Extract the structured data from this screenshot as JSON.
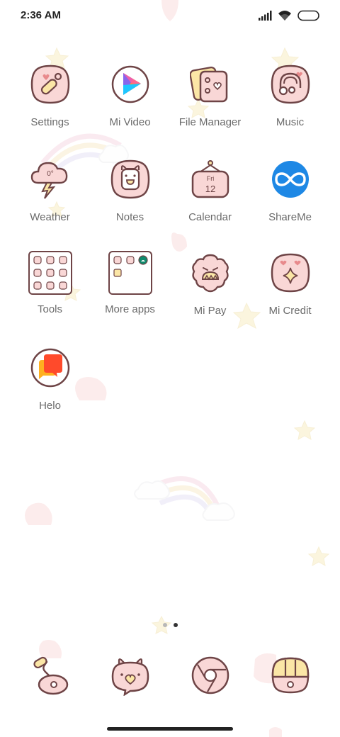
{
  "status_bar": {
    "time": "2:36 AM",
    "icons": [
      "signal-icon",
      "wifi-icon",
      "battery-icon"
    ]
  },
  "home": {
    "apps": [
      {
        "label": "Settings",
        "icon": "settings-icon"
      },
      {
        "label": "Mi Video",
        "icon": "mi-video-icon"
      },
      {
        "label": "File Manager",
        "icon": "file-manager-icon"
      },
      {
        "label": "Music",
        "icon": "music-icon"
      },
      {
        "label": "Weather",
        "icon": "weather-icon",
        "icon_text": "0°"
      },
      {
        "label": "Notes",
        "icon": "notes-icon"
      },
      {
        "label": "Calendar",
        "icon": "calendar-icon",
        "day": "Fri",
        "date": "12"
      },
      {
        "label": "ShareMe",
        "icon": "shareme-icon"
      },
      {
        "label": "Tools",
        "icon": "folder-icon"
      },
      {
        "label": "More apps",
        "icon": "folder-icon"
      },
      {
        "label": "Mi Pay",
        "icon": "mi-pay-icon"
      },
      {
        "label": "Mi Credit",
        "icon": "mi-credit-icon"
      },
      {
        "label": "Helo",
        "icon": "helo-icon"
      }
    ]
  },
  "pager": {
    "pages": 2,
    "current": 2
  },
  "dock": {
    "items": [
      {
        "icon": "phone-icon"
      },
      {
        "icon": "messages-icon"
      },
      {
        "icon": "browser-icon"
      },
      {
        "icon": "camera-icon"
      }
    ]
  },
  "colors": {
    "icon_fill": "#f9d7d6",
    "icon_stroke": "#6e4446",
    "label": "#6b6b6b",
    "shareme_blue": "#1e88e5"
  }
}
